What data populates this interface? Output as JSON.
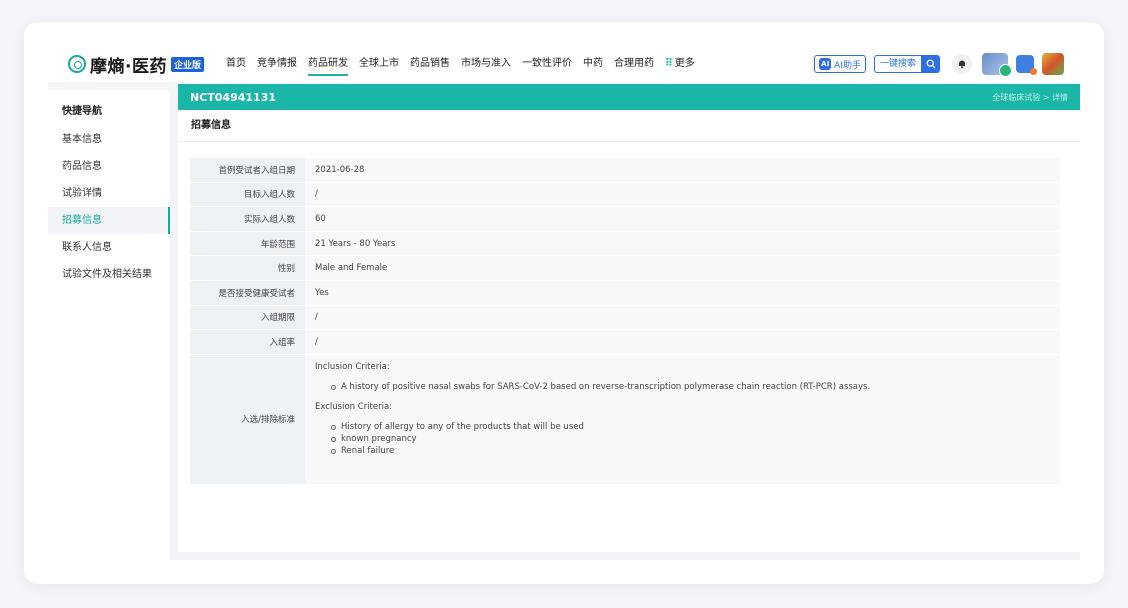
{
  "brand": {
    "name": "摩熵·医药",
    "badge": "企业版"
  },
  "nav": {
    "items": [
      {
        "label": "首页",
        "active": false
      },
      {
        "label": "竞争情报",
        "active": false
      },
      {
        "label": "药品研发",
        "active": true
      },
      {
        "label": "全球上市",
        "active": false
      },
      {
        "label": "药品销售",
        "active": false
      },
      {
        "label": "市场与准入",
        "active": false
      },
      {
        "label": "一致性评价",
        "active": false
      },
      {
        "label": "中药",
        "active": false
      },
      {
        "label": "合理用药",
        "active": false
      }
    ],
    "more_label": "更多"
  },
  "toolbar": {
    "ai_label": "AI助手",
    "ai_icon": "ai-assistant-icon",
    "search_label": "一键搜索",
    "search_icon": "search-icon",
    "bell_icon": "bell-icon"
  },
  "sidebar": {
    "title": "快捷导航",
    "items": [
      {
        "label": "基本信息",
        "active": false
      },
      {
        "label": "药品信息",
        "active": false
      },
      {
        "label": "试验详情",
        "active": false
      },
      {
        "label": "招募信息",
        "active": true
      },
      {
        "label": "联系人信息",
        "active": false
      },
      {
        "label": "试验文件及相关结果",
        "active": false
      }
    ]
  },
  "main": {
    "trial_id": "NCT04941131",
    "breadcrumb": "全球临床试验 > 详情",
    "section_title": "招募信息",
    "rows": [
      {
        "key": "首例受试者入组日期",
        "value": "2021-06-28"
      },
      {
        "key": "目标入组人数",
        "value": "/"
      },
      {
        "key": "实际入组人数",
        "value": "60"
      },
      {
        "key": "年龄范围",
        "value": "21 Years - 80 Years"
      },
      {
        "key": "性别",
        "value": "Male and Female"
      },
      {
        "key": "是否接受健康受试者",
        "value": "Yes"
      },
      {
        "key": "入组期限",
        "value": "/"
      },
      {
        "key": "入组率",
        "value": "/"
      }
    ],
    "criteria": {
      "key": "入选/排除标准",
      "inclusion_head": "Inclusion Criteria:",
      "inclusion": [
        "A history of positive nasal swabs for SARS-CoV-2 based on reverse-transcription polymerase chain reaction (RT-PCR) assays."
      ],
      "exclusion_head": "Exclusion Criteria:",
      "exclusion": [
        "History of allergy to any of the products that will be used",
        "known pregnancy",
        "Renal failure"
      ]
    }
  },
  "colors": {
    "accent": "#1ab6a8",
    "brand_blue": "#2d6fe8"
  }
}
